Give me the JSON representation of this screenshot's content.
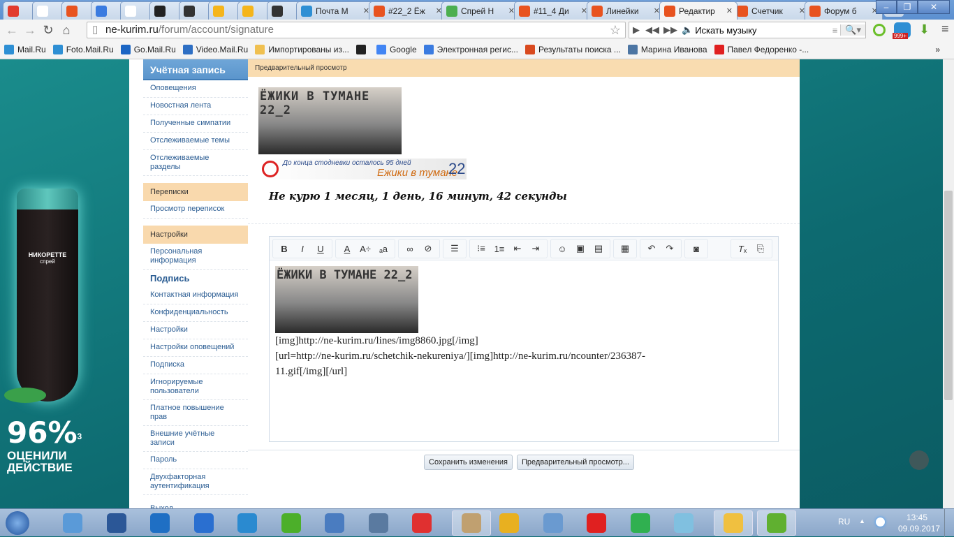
{
  "browser": {
    "tabs": [
      {
        "icon": "red-app-icon",
        "color": "#e23b2e",
        "label": ""
      },
      {
        "icon": "amazon-icon",
        "color": "#ffffff",
        "label": ""
      },
      {
        "icon": "ne-kurim-icon",
        "color": "#e8531f",
        "label": ""
      },
      {
        "icon": "arrow-icon",
        "color": "#3a7be0",
        "label": ""
      },
      {
        "icon": "yandex-icon",
        "color": "#ffffff",
        "label": ""
      },
      {
        "icon": "wifi-icon",
        "color": "#222222",
        "label": ""
      },
      {
        "icon": "home-icon",
        "color": "#333333",
        "label": ""
      },
      {
        "icon": "cloud-icon",
        "color": "#f5b51b",
        "label": ""
      },
      {
        "icon": "cloud-icon",
        "color": "#f5b51b",
        "label": ""
      },
      {
        "icon": "home-icon",
        "color": "#333333",
        "label": ""
      },
      {
        "icon": "mail-icon",
        "color": "#2e8fd4",
        "label": "Почта М"
      },
      {
        "icon": "ne-kurim-icon",
        "color": "#e8531f",
        "label": "#22_2 Ёж"
      },
      {
        "icon": "leaf-icon",
        "color": "#4caf50",
        "label": "Спрей Н"
      },
      {
        "icon": "ne-kurim-icon",
        "color": "#e8531f",
        "label": "#11_4 Ди"
      },
      {
        "icon": "ne-kurim-icon",
        "color": "#e8531f",
        "label": "Линейки"
      },
      {
        "icon": "ne-kurim-icon",
        "color": "#e8531f",
        "label": "Редактир",
        "active": true
      },
      {
        "icon": "ne-kurim-icon",
        "color": "#e8531f",
        "label": "Счетчик"
      },
      {
        "icon": "ne-kurim-icon",
        "color": "#e8531f",
        "label": "Форум б"
      }
    ],
    "url_domain": "ne-kurim.ru",
    "url_path": "/forum/account/signature",
    "music_placeholder": "Искать музыку",
    "badge": "999+",
    "bookmarks": [
      {
        "label": "Mail.Ru",
        "color": "#2e8fd4"
      },
      {
        "label": "Foto.Mail.Ru",
        "color": "#2e8fd4"
      },
      {
        "label": "Go.Mail.Ru",
        "color": "#1c66c4"
      },
      {
        "label": "Video.Mail.Ru",
        "color": "#2e6fc4"
      },
      {
        "label": "Импортированы из...",
        "color": "#f0c050"
      },
      {
        "label": "",
        "color": "#222222"
      },
      {
        "label": "Google",
        "color": "#4285f4"
      },
      {
        "label": "Электронная регис...",
        "color": "#3a7be0"
      },
      {
        "label": "Результаты поиска ...",
        "color": "#d94a1f"
      },
      {
        "label": "Марина Иванова",
        "color": "#4c75a3"
      },
      {
        "label": "Павел Федоренко -...",
        "color": "#e02020"
      }
    ],
    "more": "»"
  },
  "ad": {
    "brand": "НИКОРЕТТЕ",
    "product": "спрей",
    "percent": "96%",
    "sup": "3",
    "line1": "ОЦЕНИЛИ",
    "line2": "ДЕЙСТВИЕ"
  },
  "sidebar": {
    "title": "Учётная запись",
    "group1": [
      "Оповещения",
      "Новостная лента",
      "Полученные симпатии",
      "Отслеживаемые темы",
      "Отслеживаемые разделы"
    ],
    "section2": "Переписки",
    "group2": [
      "Просмотр переписок"
    ],
    "section3": "Настройки",
    "group3a": [
      "Персональная информация"
    ],
    "current": "Подпись",
    "group3b": [
      "Контактная информация",
      "Конфиденциальность",
      "Настройки",
      "Настройки оповещений",
      "Подписка",
      "Игнорируемые пользователи",
      "Платное повышение прав",
      "Внешние учётные записи",
      "Пароль",
      "Двухфакторная аутентификация"
    ],
    "logout": "Выход"
  },
  "preview": {
    "header": "Предварительный просмотр",
    "banner_text": "ЁЖИКИ В ТУМАНЕ 22_2",
    "counter_text": "До конца стодневки осталось 95 дней",
    "counter_title": "Ежики в тумане",
    "counter_num": "22",
    "quit_text": "Не курю 1 месяц, 1 день, 16 минут, 42 секунды"
  },
  "editor": {
    "toolbar": [
      [
        "B",
        "I",
        "U"
      ],
      [
        "A",
        "A÷",
        "ₐa"
      ],
      [
        "link",
        "unlink"
      ],
      [
        "align"
      ],
      [
        "ul",
        "ol",
        "outdent",
        "indent"
      ],
      [
        "smiley",
        "image",
        "media"
      ],
      [
        "template"
      ],
      [
        "undo",
        "redo"
      ],
      [
        "camera"
      ]
    ],
    "line1": "[img]http://ne-kurim.ru/lines/img8860.jpg[/img]",
    "line2": "[url=http://ne-kurim.ru/schetchik-nekureniya/][img]http://ne-kurim.ru/ncounter/236387-",
    "line3": "11.gif[/img][/url]"
  },
  "buttons": {
    "save": "Сохранить изменения",
    "preview": "Предварительный просмотр..."
  },
  "taskbar": {
    "lang": "RU",
    "time": "13:45",
    "date": "09.09.2017",
    "apps": [
      {
        "name": "control-panel",
        "color": "#5a9ad8"
      },
      {
        "name": "word",
        "color": "#2b5797"
      },
      {
        "name": "mail-agent",
        "color": "#1f6fc4"
      },
      {
        "name": "app-blue",
        "color": "#2a6fd0"
      },
      {
        "name": "app-share",
        "color": "#2a8ad0"
      },
      {
        "name": "app-a",
        "color": "#4caf2a"
      },
      {
        "name": "volume",
        "color": "#4a7cc0"
      },
      {
        "name": "keyboard",
        "color": "#5a7aa0"
      },
      {
        "name": "yandex",
        "color": "#e03030"
      },
      {
        "name": "paint",
        "color": "#c0a070"
      },
      {
        "name": "chrome",
        "color": "#e8b020"
      },
      {
        "name": "calculator",
        "color": "#6a9ad0"
      },
      {
        "name": "yandex-browser",
        "color": "#e02020"
      },
      {
        "name": "agent",
        "color": "#30b050"
      },
      {
        "name": "notepad",
        "color": "#80c0e0"
      },
      {
        "name": "explorer",
        "color": "#f0c040"
      },
      {
        "name": "app-green",
        "color": "#60b030"
      }
    ]
  }
}
